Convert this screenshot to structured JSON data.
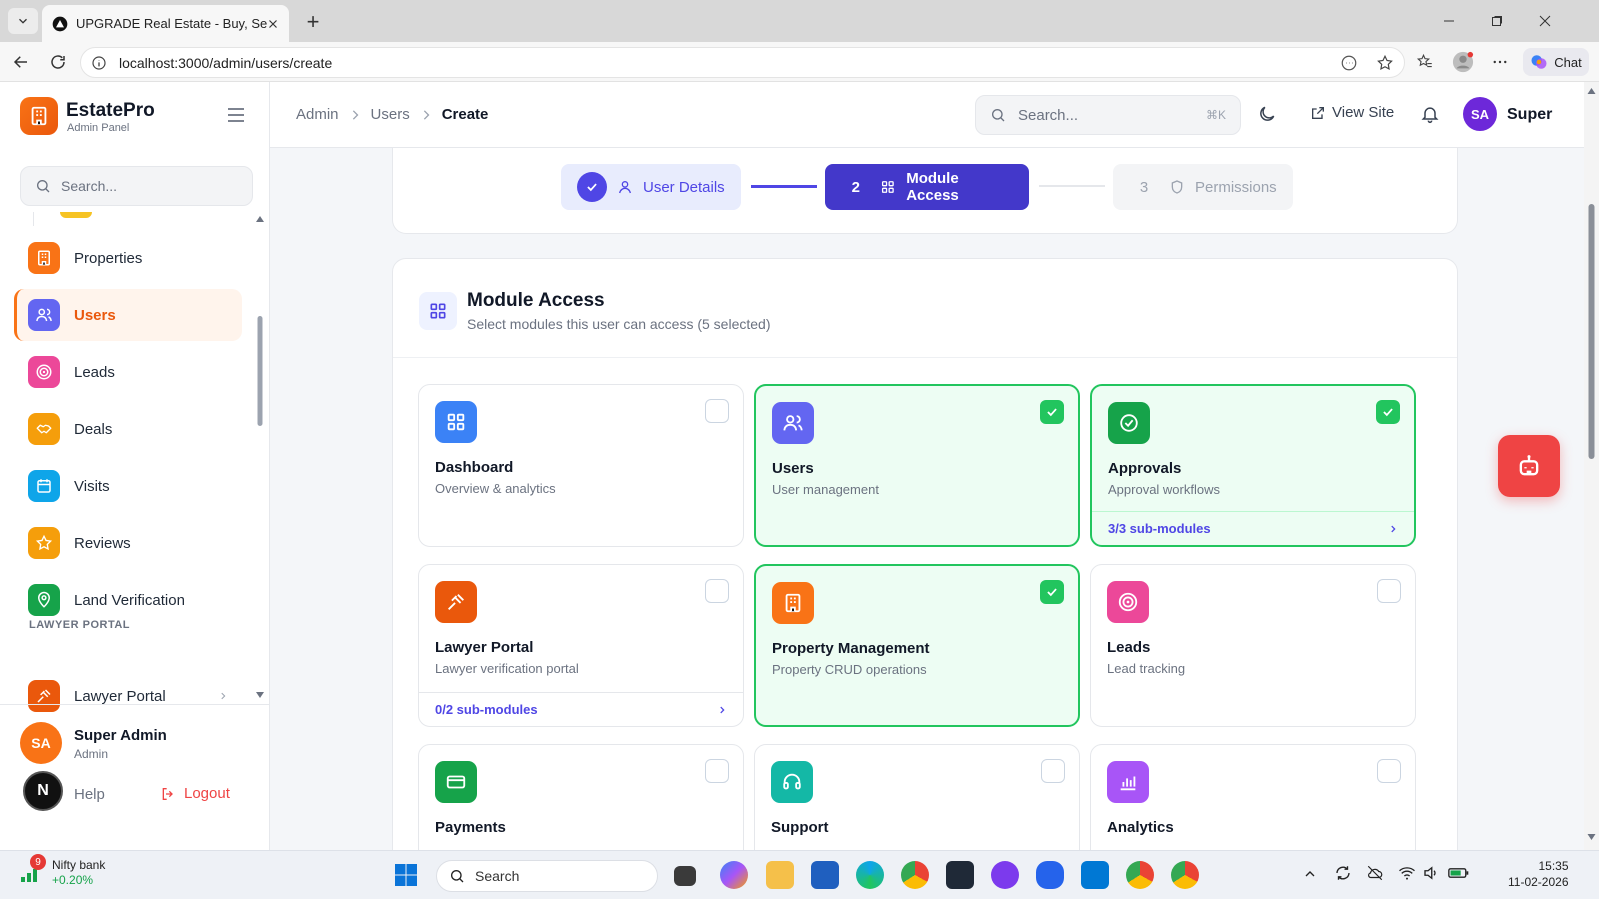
{
  "browser": {
    "tab_title": "UPGRADE Real Estate - Buy, Sell &",
    "url": "localhost:3000/admin/users/create",
    "chat_label": "Chat"
  },
  "brand": {
    "name": "EstatePro",
    "subtitle": "Admin Panel"
  },
  "sidebar": {
    "search_placeholder": "Search...",
    "items": [
      {
        "label": "Properties",
        "icon": "building-icon",
        "color": "#f97316"
      },
      {
        "label": "Users",
        "icon": "users-icon",
        "color": "#6366f1",
        "active": true
      },
      {
        "label": "Leads",
        "icon": "target-icon",
        "color": "#ec4899"
      },
      {
        "label": "Deals",
        "icon": "handshake-icon",
        "color": "#f59e0b"
      },
      {
        "label": "Visits",
        "icon": "calendar-icon",
        "color": "#0ea5e9"
      },
      {
        "label": "Reviews",
        "icon": "star-icon",
        "color": "#f59e0b"
      },
      {
        "label": "Land Verification",
        "icon": "map-pin-icon",
        "color": "#16a34a"
      }
    ],
    "section_lawyer": "LAWYER PORTAL",
    "lawyer_item": "Lawyer Portal",
    "user": {
      "initials": "SA",
      "name": "Super Admin",
      "role": "Admin"
    },
    "help_label": "Help",
    "logout_label": "Logout",
    "help_avatar": "N"
  },
  "header": {
    "breadcrumb": [
      "Admin",
      "Users",
      "Create"
    ],
    "search_placeholder": "Search...",
    "search_shortcut": "⌘K",
    "view_site": "View Site",
    "avatar": "SA",
    "user_name": "Super"
  },
  "stepper": {
    "steps": [
      {
        "label": "User Details",
        "state": "done"
      },
      {
        "number": "2",
        "label": "Module Access",
        "state": "active"
      },
      {
        "number": "3",
        "label": "Permissions",
        "state": "pending"
      }
    ]
  },
  "module_access": {
    "title": "Module Access",
    "subtitle": "Select modules this user can access (5 selected)",
    "modules": [
      {
        "title": "Dashboard",
        "desc": "Overview & analytics",
        "selected": false,
        "color": "#3b82f6",
        "icon": "grid-icon"
      },
      {
        "title": "Users",
        "desc": "User management",
        "selected": true,
        "color": "#6366f1",
        "icon": "users-icon"
      },
      {
        "title": "Approvals",
        "desc": "Approval workflows",
        "selected": true,
        "color": "#16a34a",
        "icon": "check-circle-icon",
        "sub": "3/3 sub-modules"
      },
      {
        "title": "Lawyer Portal",
        "desc": "Lawyer verification portal",
        "selected": false,
        "color": "#ea580c",
        "icon": "gavel-icon",
        "sub": "0/2 sub-modules"
      },
      {
        "title": "Property Management",
        "desc": "Property CRUD operations",
        "selected": true,
        "color": "#f97316",
        "icon": "building-icon"
      },
      {
        "title": "Leads",
        "desc": "Lead tracking",
        "selected": false,
        "color": "#ec4899",
        "icon": "target-icon"
      },
      {
        "title": "Payments",
        "desc": "",
        "selected": false,
        "color": "#16a34a",
        "icon": "credit-card-icon"
      },
      {
        "title": "Support",
        "desc": "",
        "selected": false,
        "color": "#14b8a6",
        "icon": "headset-icon"
      },
      {
        "title": "Analytics",
        "desc": "",
        "selected": false,
        "color": "#a855f7",
        "icon": "bar-chart-icon"
      }
    ]
  },
  "taskbar": {
    "ticker_name": "Nifty bank",
    "ticker_change": "+0.20%",
    "ticker_badge": "9",
    "search_label": "Search",
    "time": "15:35",
    "date": "11-02-2026"
  }
}
